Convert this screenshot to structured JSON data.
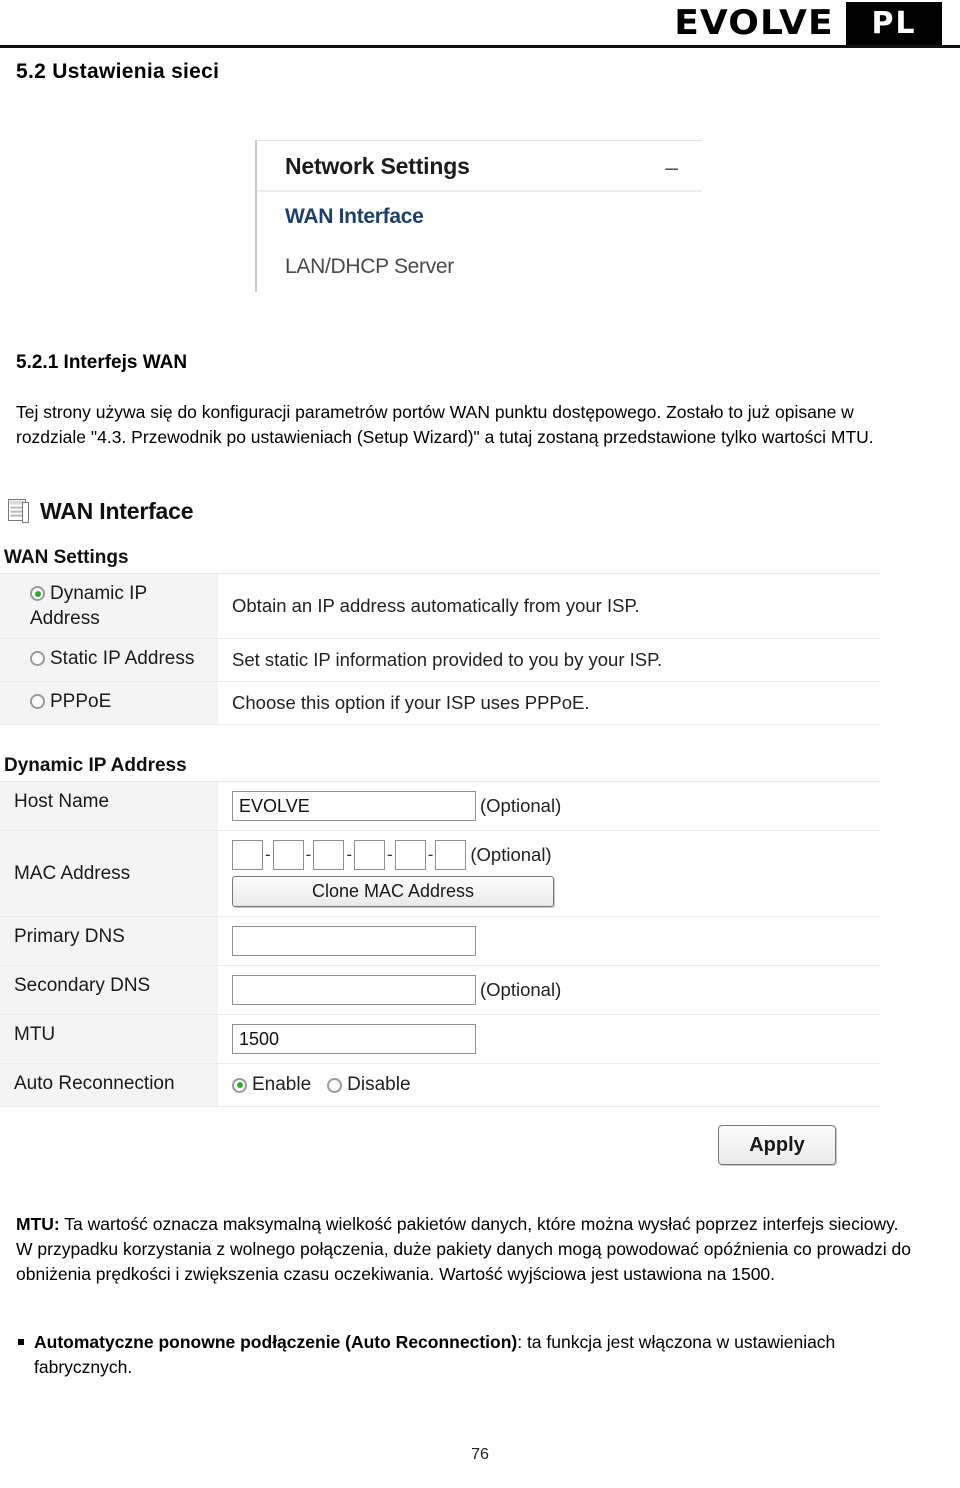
{
  "header": {
    "brand": "EVOLVE",
    "language_badge": "PL"
  },
  "section": {
    "title": "5.2 Ustawienia sieci"
  },
  "network_settings_shot": {
    "panel_title": "Network Settings",
    "collapse_icon": "minus-icon",
    "items": [
      {
        "label": "WAN Interface",
        "active": true
      },
      {
        "label": "LAN/DHCP Server",
        "active": false
      }
    ]
  },
  "subsection": {
    "title": "5.2.1 Interfejs WAN",
    "paragraph": "Tej strony używa się do konfiguracji parametrów portów WAN punktu dostępowego. Zostało to już opisane w rozdziale \"4.3.  Przewodnik po ustawieniach (Setup Wizard)\" a tutaj zostaną przedstawione tylko wartości MTU."
  },
  "wan_panel": {
    "icon": "window-list-icon",
    "title": "WAN Interface",
    "wan_settings": {
      "group_label": "WAN Settings",
      "rows": [
        {
          "label": "Dynamic IP Address",
          "selected": true,
          "description": "Obtain an IP address automatically from your ISP."
        },
        {
          "label": "Static IP Address",
          "selected": false,
          "description": "Set static IP information provided to you by your ISP."
        },
        {
          "label": "PPPoE",
          "selected": false,
          "description": "Choose this option if your ISP uses PPPoE."
        }
      ]
    },
    "dynamic_ip": {
      "group_label": "Dynamic IP Address",
      "host_name": {
        "label": "Host Name",
        "value": "EVOLVE",
        "hint": "(Optional)"
      },
      "mac_address": {
        "label": "MAC Address",
        "octets": [
          "",
          "",
          "",
          "",
          "",
          ""
        ],
        "separator": "-",
        "hint": "(Optional)",
        "clone_button": "Clone MAC Address"
      },
      "primary_dns": {
        "label": "Primary DNS",
        "value": "",
        "hint": ""
      },
      "secondary_dns": {
        "label": "Secondary DNS",
        "value": "",
        "hint": "(Optional)"
      },
      "mtu": {
        "label": "MTU",
        "value": "1500"
      },
      "auto_reconnection": {
        "label": "Auto Reconnection",
        "options": [
          {
            "label": "Enable",
            "selected": true
          },
          {
            "label": "Disable",
            "selected": false
          }
        ]
      }
    },
    "apply_button": "Apply"
  },
  "notes": {
    "mtu_label": "MTU:",
    "mtu_text": " Ta wartość oznacza maksymalną wielkość pakietów danych, które można wysłać poprzez interfejs sieciowy. W przypadku korzystania z wolnego połączenia, duże pakiety danych mogą powodować opóźnienia co prowadzi do obniżenia prędkości i zwiększenia czasu oczekiwania. Wartość wyjściowa jest ustawiona na 1500.",
    "auto_reconnection_label": "Automatyczne ponowne podłączenie (Auto Reconnection)",
    "auto_reconnection_text": ": ta funkcja jest włączona w ustawieniach fabrycznych."
  },
  "footer": {
    "page_number": "76"
  }
}
